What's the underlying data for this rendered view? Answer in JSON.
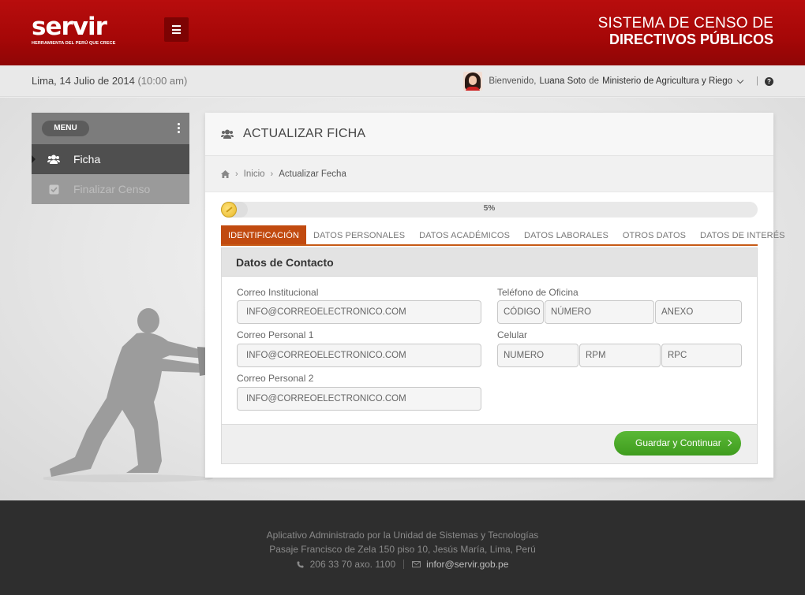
{
  "header": {
    "logo_text": "servir",
    "logo_tagline": "HERRAMIENTA DEL PERÚ QUE CRECE",
    "title_line1": "SISTEMA DE CENSO  DE",
    "title_line2": "DIRECTIVOS PÚBLICOS"
  },
  "infobar": {
    "date": "Lima, 14 Julio de 2014",
    "time": "(10:00 am)",
    "welcome": "Bienvenido,",
    "user_name": "Luana Soto",
    "de": "de",
    "organization": "Ministerio de Agricultura y Riego",
    "separator": "|"
  },
  "sidebar": {
    "menu_label": "MENU",
    "items": [
      {
        "label": "Ficha",
        "icon": "users-icon",
        "active": true
      },
      {
        "label": "Finalizar Censo",
        "icon": "checkbox-icon",
        "active": false
      }
    ]
  },
  "panel": {
    "title": "ACTUALIZAR FICHA",
    "breadcrumb": {
      "home": "Inicio",
      "current": "Actualizar Fecha"
    },
    "progress": {
      "percent": 5,
      "label": "5%"
    },
    "tabs": [
      {
        "label": "IDENTIFICACIÓN",
        "active": true
      },
      {
        "label": "DATOS PERSONALES",
        "active": false
      },
      {
        "label": "DATOS ACADÉMICOS",
        "active": false
      },
      {
        "label": "DATOS LABORALES",
        "active": false
      },
      {
        "label": "OTROS DATOS",
        "active": false
      },
      {
        "label": "DATOS DE INTERÉS",
        "active": false
      }
    ],
    "section_title": "Datos de Contacto",
    "fields": {
      "correo_institucional": {
        "label": "Correo Institucional",
        "value": "INFO@CORREOELECTRONICO.COM"
      },
      "correo_personal_1": {
        "label": "Correo Personal 1",
        "value": "INFO@CORREOELECTRONICO.COM"
      },
      "correo_personal_2": {
        "label": "Correo Personal 2",
        "value": "INFO@CORREOELECTRONICO.COM"
      },
      "telefono_oficina": {
        "label": "Teléfono de Oficina",
        "codigo": "CÓDIGO",
        "numero": "NÚMERO",
        "anexo": "ANEXO"
      },
      "celular": {
        "label": "Celular",
        "numero": "NUMERO",
        "rpm": "RPM",
        "rpc": "RPC"
      }
    },
    "save_button": "Guardar y Continuar"
  },
  "footer": {
    "line1": "Aplicativo Administrado por la Unidad de Sistemas y Tecnologías",
    "line2": "Pasaje Francisco de Zela 150 piso 10, Jesús María, Lima, Perú",
    "phone": "206 33 70 axo. 1100",
    "email": "infor@servir.gob.pe"
  },
  "colors": {
    "brand_red": "#a50707",
    "tab_active": "#c14a0f",
    "save_green": "#4caa29",
    "footer_bg": "#2e2e2e"
  }
}
